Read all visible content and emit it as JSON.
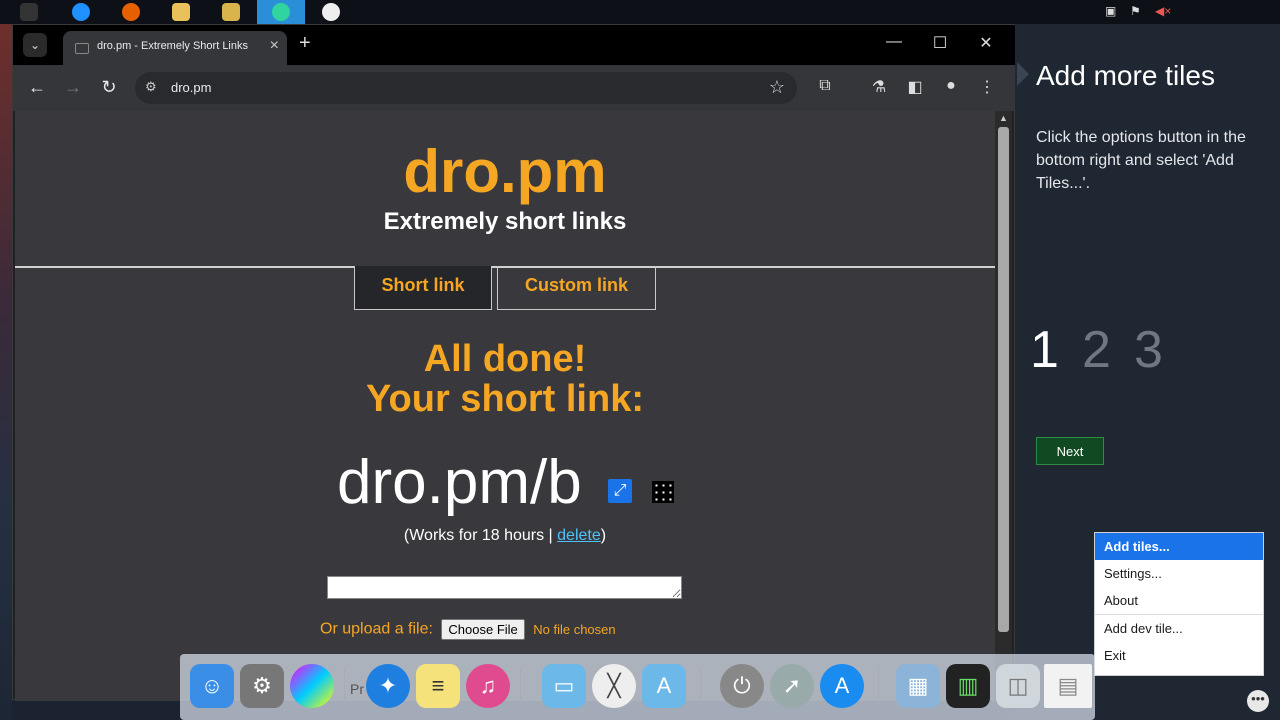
{
  "taskbar": {
    "icons": [
      "apple-icon",
      "ie-icon",
      "firefox-icon",
      "file-explorer-icon",
      "media-player-icon",
      "dro-app-icon",
      "clock-icon"
    ],
    "tray_icons": [
      "network-icon",
      "flag-icon",
      "speaker-muted-icon"
    ]
  },
  "browser": {
    "tab_title": "dro.pm - Extremely Short Links",
    "url": "dro.pm",
    "controls": {
      "minimize": "—",
      "maximize": "☐",
      "close": "✕"
    }
  },
  "page": {
    "brand": "dro.pm",
    "tagline": "Extremely short links",
    "tabs": [
      {
        "label": "Short link"
      },
      {
        "label": "Custom link"
      }
    ],
    "done_line1": "All done!",
    "done_line2": "Your short link:",
    "short_url": "dro.pm/b",
    "works_prefix": "(Works for 18 hours | ",
    "delete_label": "delete",
    "works_suffix": ")",
    "url_input_value": "",
    "upload_label": "Or upload a file:",
    "choose_file_label": "Choose File",
    "no_file_label": "No file chosen"
  },
  "side_panel": {
    "title": "Add more tiles",
    "description": "Click the options button in the bottom right and select 'Add Tiles...'.",
    "steps": [
      "1",
      "2",
      "3"
    ],
    "active_step": 1,
    "next_label": "Next"
  },
  "context_menu": {
    "items": [
      "Add tiles...",
      "Settings...",
      "About",
      "Add dev tile...",
      "Exit"
    ],
    "highlighted": "Add tiles..."
  },
  "dock": {
    "label_fragment": "Pr      ile        oad",
    "icons": [
      "finder-icon",
      "system-preferences-icon",
      "game-center-icon",
      "safari-icon",
      "notes-icon",
      "itunes-icon",
      "folder-icon",
      "x-app-icon",
      "applications-folder-icon",
      "power-icon",
      "launchpad-icon",
      "app-store-icon",
      "preview-icon",
      "activity-monitor-icon",
      "trash-icon",
      "document-thumbnail-icon"
    ]
  }
}
